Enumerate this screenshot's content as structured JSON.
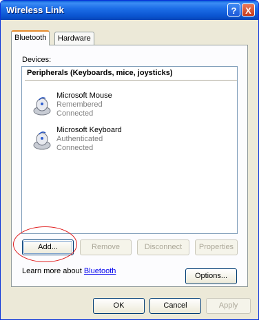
{
  "window": {
    "title": "Wireless Link"
  },
  "titlebar_buttons": {
    "help": "?",
    "close": "X"
  },
  "tabs": [
    {
      "label": "Bluetooth",
      "selected": true
    },
    {
      "label": "Hardware",
      "selected": false
    }
  ],
  "devices_label": "Devices:",
  "group_header": "Peripherals (Keyboards, mice, joysticks)",
  "devices": [
    {
      "name": "Microsoft Mouse",
      "status1": "Remembered",
      "status2": "Connected",
      "icon": "mouse-device-icon"
    },
    {
      "name": "Microsoft Keyboard",
      "status1": "Authenticated",
      "status2": "Connected",
      "icon": "keyboard-device-icon"
    }
  ],
  "buttons": {
    "add": "Add...",
    "remove": "Remove",
    "disconnect": "Disconnect",
    "properties": "Properties",
    "options": "Options...",
    "ok": "OK",
    "cancel": "Cancel",
    "apply": "Apply"
  },
  "learn": {
    "prefix": "Learn more about ",
    "link": "Bluetooth"
  },
  "colors": {
    "titlebar": "#0a54d0",
    "highlight_circle": "#e02020",
    "link": "#0000ee"
  }
}
